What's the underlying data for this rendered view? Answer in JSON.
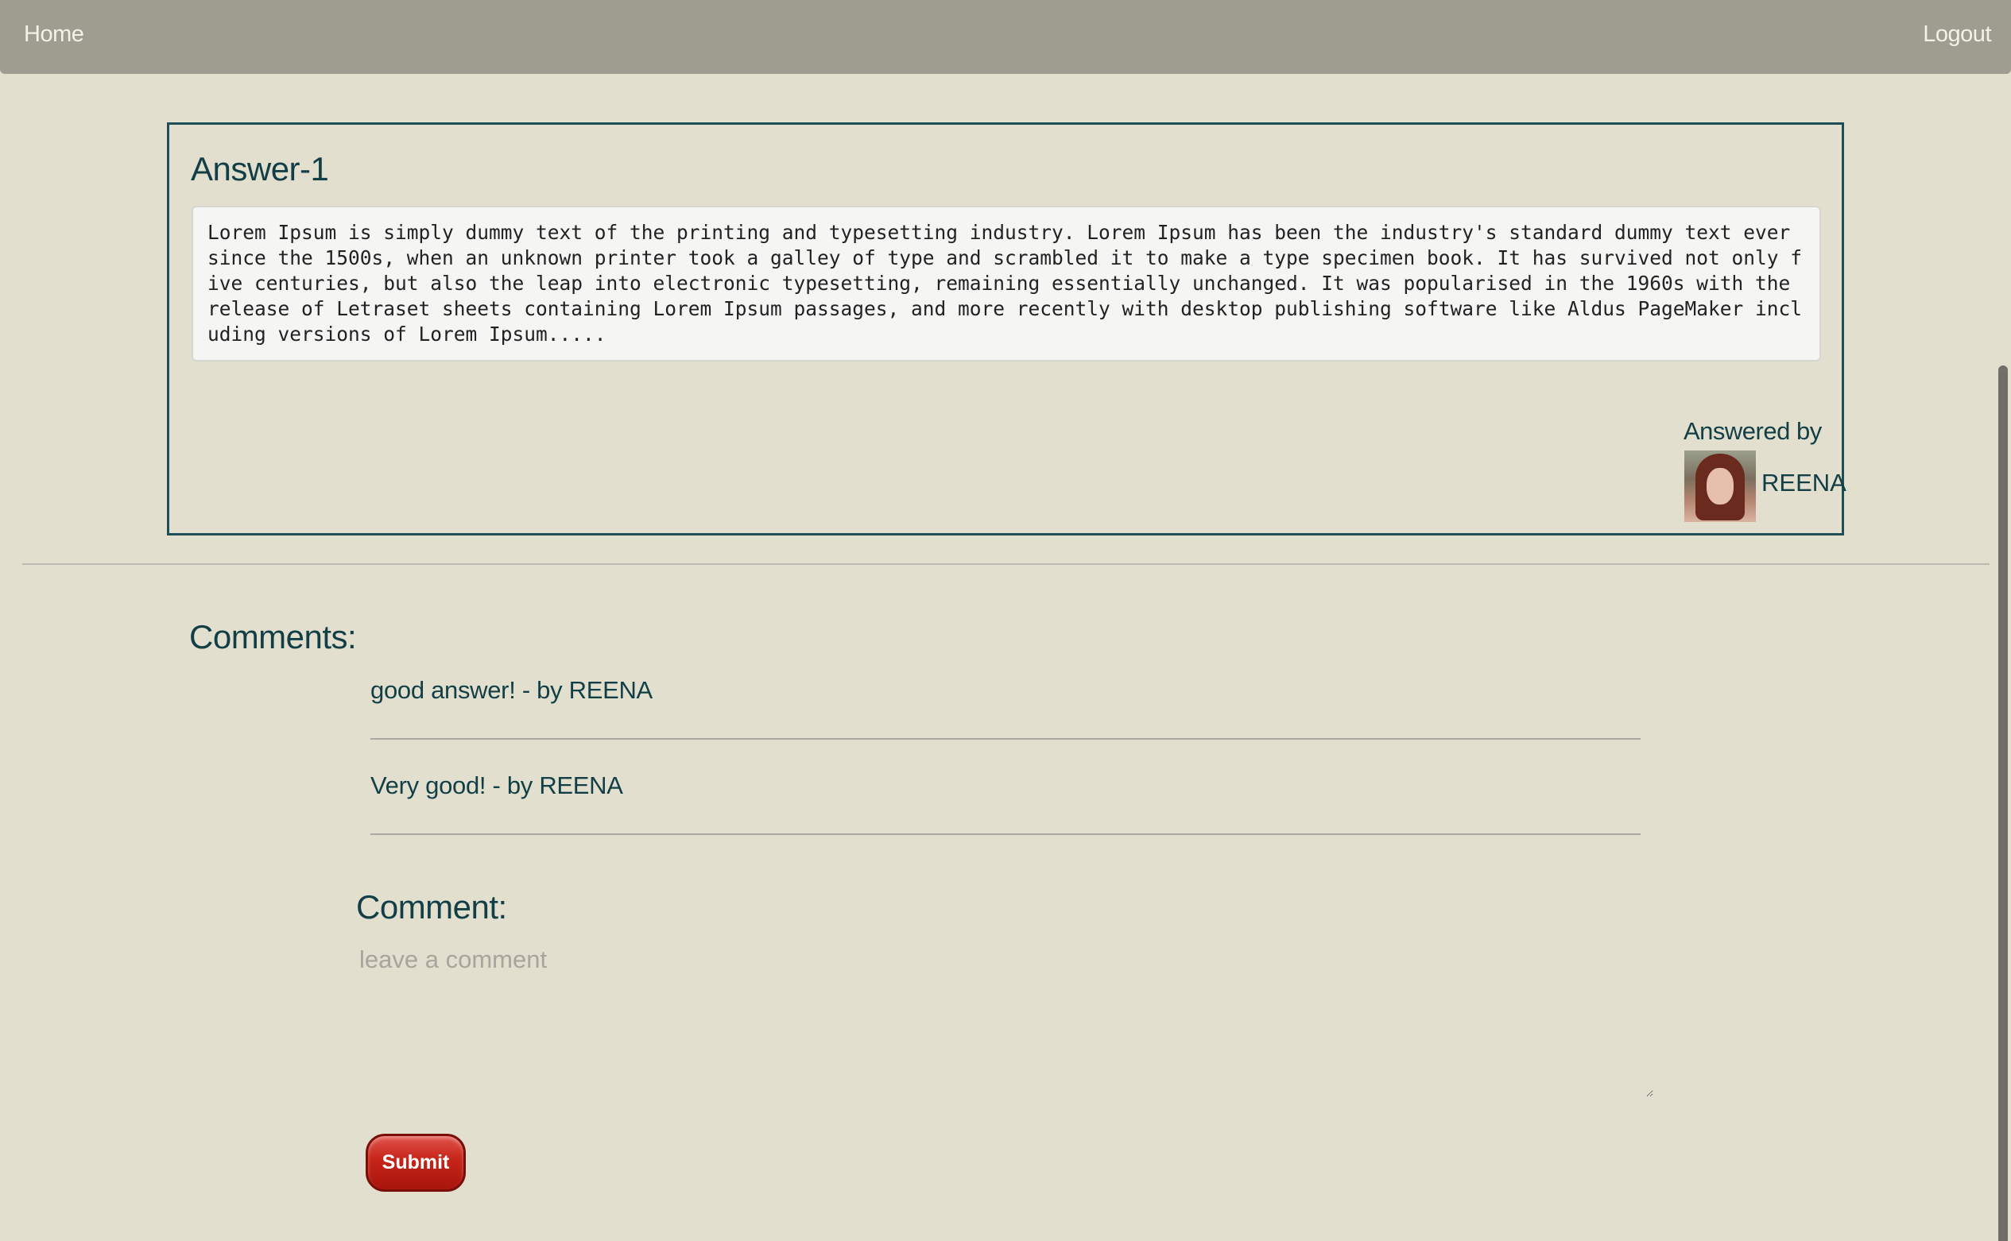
{
  "nav": {
    "home": "Home",
    "logout": "Logout"
  },
  "answer": {
    "title": "Answer-1",
    "text": "Lorem Ipsum is simply dummy text of the printing and typesetting industry. Lorem Ipsum has been the industry's standard dummy text ever since the 1500s, when an unknown printer took a galley of type and scrambled it to make a type specimen book. It has survived not only five centuries, but also the leap into electronic typesetting, remaining essentially unchanged. It was popularised in the 1960s with the release of Letraset sheets containing Lorem Ipsum passages, and more recently with desktop publishing software like Aldus PageMaker including versions of Lorem Ipsum.....",
    "answered_by_label": "Answered by",
    "author": "REENA"
  },
  "comments": {
    "heading": "Comments:",
    "items": [
      {
        "text": "good answer! - by REENA"
      },
      {
        "text": "Very good! - by REENA"
      }
    ]
  },
  "comment_form": {
    "label": "Comment:",
    "placeholder": "leave a comment",
    "value": "",
    "submit_label": "Submit"
  }
}
